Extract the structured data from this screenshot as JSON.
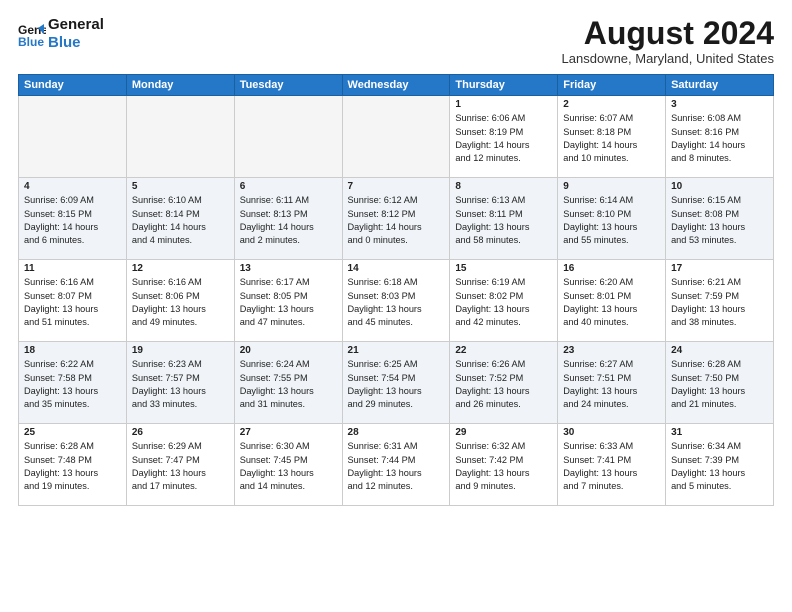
{
  "header": {
    "logo_line1": "General",
    "logo_line2": "Blue",
    "month_title": "August 2024",
    "location": "Lansdowne, Maryland, United States"
  },
  "weekdays": [
    "Sunday",
    "Monday",
    "Tuesday",
    "Wednesday",
    "Thursday",
    "Friday",
    "Saturday"
  ],
  "weeks": [
    [
      {
        "day": "",
        "info": ""
      },
      {
        "day": "",
        "info": ""
      },
      {
        "day": "",
        "info": ""
      },
      {
        "day": "",
        "info": ""
      },
      {
        "day": "1",
        "info": "Sunrise: 6:06 AM\nSunset: 8:19 PM\nDaylight: 14 hours\nand 12 minutes."
      },
      {
        "day": "2",
        "info": "Sunrise: 6:07 AM\nSunset: 8:18 PM\nDaylight: 14 hours\nand 10 minutes."
      },
      {
        "day": "3",
        "info": "Sunrise: 6:08 AM\nSunset: 8:16 PM\nDaylight: 14 hours\nand 8 minutes."
      }
    ],
    [
      {
        "day": "4",
        "info": "Sunrise: 6:09 AM\nSunset: 8:15 PM\nDaylight: 14 hours\nand 6 minutes."
      },
      {
        "day": "5",
        "info": "Sunrise: 6:10 AM\nSunset: 8:14 PM\nDaylight: 14 hours\nand 4 minutes."
      },
      {
        "day": "6",
        "info": "Sunrise: 6:11 AM\nSunset: 8:13 PM\nDaylight: 14 hours\nand 2 minutes."
      },
      {
        "day": "7",
        "info": "Sunrise: 6:12 AM\nSunset: 8:12 PM\nDaylight: 14 hours\nand 0 minutes."
      },
      {
        "day": "8",
        "info": "Sunrise: 6:13 AM\nSunset: 8:11 PM\nDaylight: 13 hours\nand 58 minutes."
      },
      {
        "day": "9",
        "info": "Sunrise: 6:14 AM\nSunset: 8:10 PM\nDaylight: 13 hours\nand 55 minutes."
      },
      {
        "day": "10",
        "info": "Sunrise: 6:15 AM\nSunset: 8:08 PM\nDaylight: 13 hours\nand 53 minutes."
      }
    ],
    [
      {
        "day": "11",
        "info": "Sunrise: 6:16 AM\nSunset: 8:07 PM\nDaylight: 13 hours\nand 51 minutes."
      },
      {
        "day": "12",
        "info": "Sunrise: 6:16 AM\nSunset: 8:06 PM\nDaylight: 13 hours\nand 49 minutes."
      },
      {
        "day": "13",
        "info": "Sunrise: 6:17 AM\nSunset: 8:05 PM\nDaylight: 13 hours\nand 47 minutes."
      },
      {
        "day": "14",
        "info": "Sunrise: 6:18 AM\nSunset: 8:03 PM\nDaylight: 13 hours\nand 45 minutes."
      },
      {
        "day": "15",
        "info": "Sunrise: 6:19 AM\nSunset: 8:02 PM\nDaylight: 13 hours\nand 42 minutes."
      },
      {
        "day": "16",
        "info": "Sunrise: 6:20 AM\nSunset: 8:01 PM\nDaylight: 13 hours\nand 40 minutes."
      },
      {
        "day": "17",
        "info": "Sunrise: 6:21 AM\nSunset: 7:59 PM\nDaylight: 13 hours\nand 38 minutes."
      }
    ],
    [
      {
        "day": "18",
        "info": "Sunrise: 6:22 AM\nSunset: 7:58 PM\nDaylight: 13 hours\nand 35 minutes."
      },
      {
        "day": "19",
        "info": "Sunrise: 6:23 AM\nSunset: 7:57 PM\nDaylight: 13 hours\nand 33 minutes."
      },
      {
        "day": "20",
        "info": "Sunrise: 6:24 AM\nSunset: 7:55 PM\nDaylight: 13 hours\nand 31 minutes."
      },
      {
        "day": "21",
        "info": "Sunrise: 6:25 AM\nSunset: 7:54 PM\nDaylight: 13 hours\nand 29 minutes."
      },
      {
        "day": "22",
        "info": "Sunrise: 6:26 AM\nSunset: 7:52 PM\nDaylight: 13 hours\nand 26 minutes."
      },
      {
        "day": "23",
        "info": "Sunrise: 6:27 AM\nSunset: 7:51 PM\nDaylight: 13 hours\nand 24 minutes."
      },
      {
        "day": "24",
        "info": "Sunrise: 6:28 AM\nSunset: 7:50 PM\nDaylight: 13 hours\nand 21 minutes."
      }
    ],
    [
      {
        "day": "25",
        "info": "Sunrise: 6:28 AM\nSunset: 7:48 PM\nDaylight: 13 hours\nand 19 minutes."
      },
      {
        "day": "26",
        "info": "Sunrise: 6:29 AM\nSunset: 7:47 PM\nDaylight: 13 hours\nand 17 minutes."
      },
      {
        "day": "27",
        "info": "Sunrise: 6:30 AM\nSunset: 7:45 PM\nDaylight: 13 hours\nand 14 minutes."
      },
      {
        "day": "28",
        "info": "Sunrise: 6:31 AM\nSunset: 7:44 PM\nDaylight: 13 hours\nand 12 minutes."
      },
      {
        "day": "29",
        "info": "Sunrise: 6:32 AM\nSunset: 7:42 PM\nDaylight: 13 hours\nand 9 minutes."
      },
      {
        "day": "30",
        "info": "Sunrise: 6:33 AM\nSunset: 7:41 PM\nDaylight: 13 hours\nand 7 minutes."
      },
      {
        "day": "31",
        "info": "Sunrise: 6:34 AM\nSunset: 7:39 PM\nDaylight: 13 hours\nand 5 minutes."
      }
    ]
  ]
}
